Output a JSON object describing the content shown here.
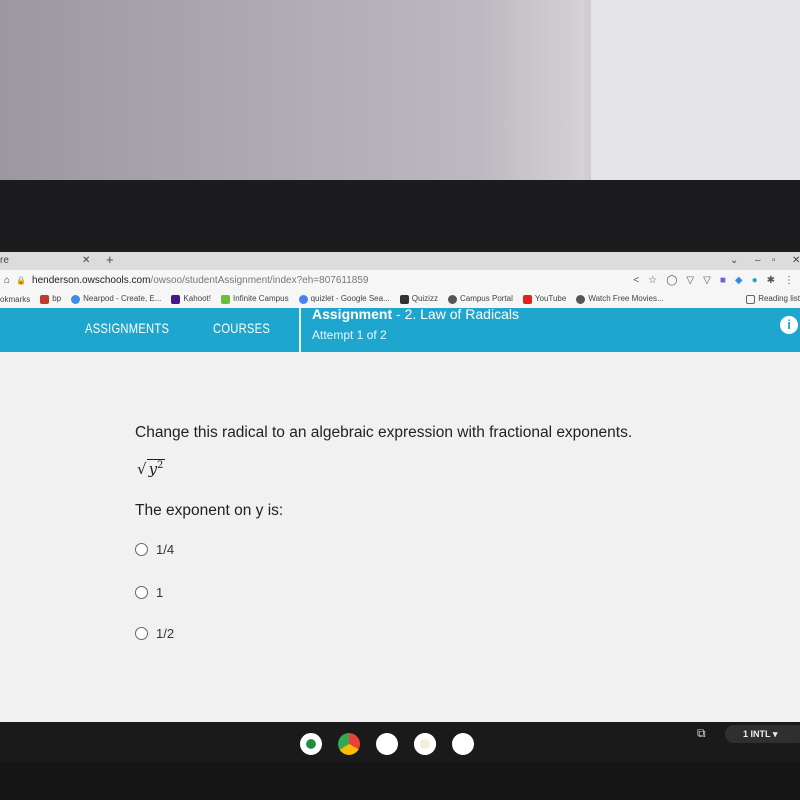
{
  "browser": {
    "tab_title": "re",
    "url_host": "henderson.owschools.com",
    "url_path": "/owsoo/studentAssignment/index?eh=807611859",
    "bookmarks": [
      "okmarks",
      "bp",
      "Nearpod - Create, E...",
      "Kahoot!",
      "Infinite Campus",
      "quizlet - Google Sea...",
      "Quizizz",
      "Campus Portal",
      "YouTube",
      "Watch Free Movies..."
    ],
    "reading_list": "Reading list"
  },
  "nav": {
    "assignments": "ASSIGNMENTS",
    "courses": "COURSES",
    "assignment_label": "Assignment",
    "assignment_name": "- 2. Law of Radicals",
    "attempt": "Attempt 1 of 2",
    "info": "i"
  },
  "question": {
    "text": "Change this radical to an algebraic expression with fractional exponents.",
    "radicand": "y",
    "radicand_exp": "2",
    "prompt": "The exponent on y is:",
    "options": [
      "1/4",
      "1",
      "1/2"
    ]
  },
  "shelf": {
    "ime": "INTL",
    "notif": "1",
    "accent": "#1ea6cf"
  }
}
